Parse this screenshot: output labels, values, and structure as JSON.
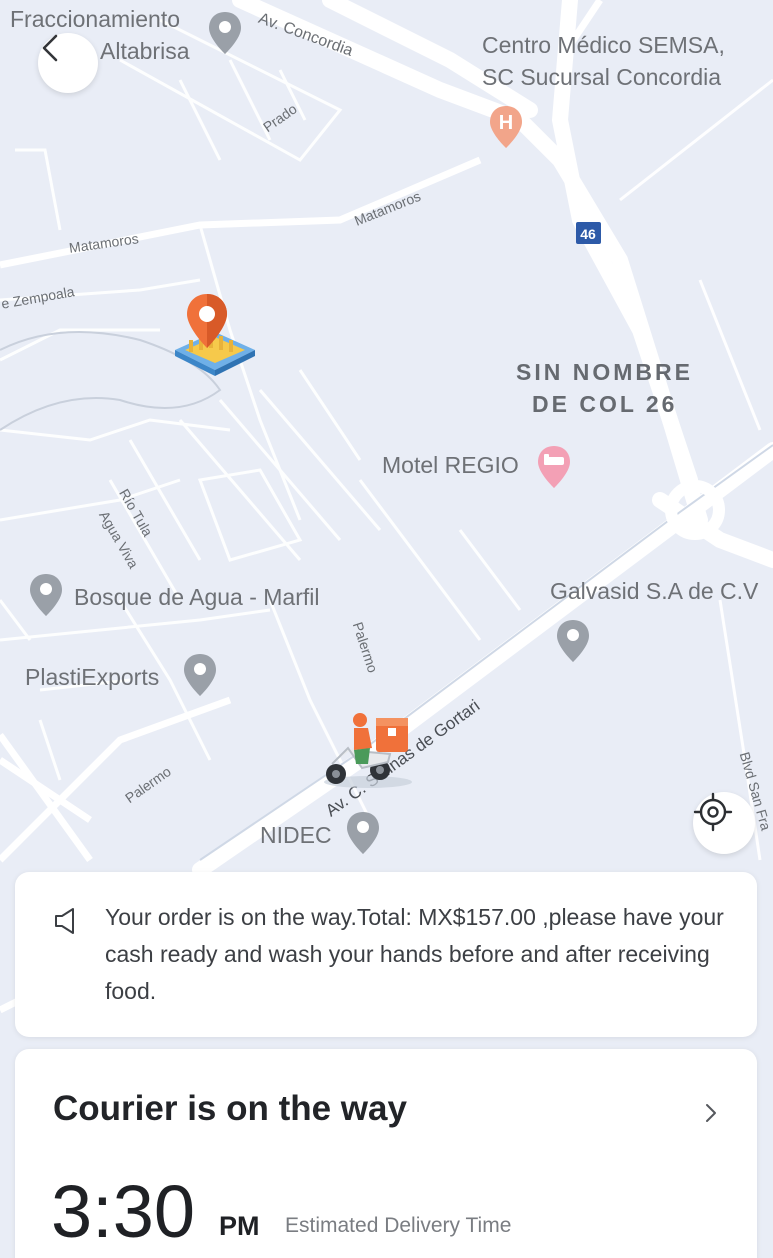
{
  "map": {
    "place_labels": {
      "fraccionamiento_l1": "Fraccionamiento",
      "fraccionamiento_l2": "Altabrisa",
      "centro_medico_l1": "Centro Médico SEMSA,",
      "centro_medico_l2": "SC Sucursal Concordia",
      "sin_nombre_l1": "SIN NOMBRE",
      "sin_nombre_l2": "DE COL 26",
      "motel": "Motel REGIO",
      "galvasid": "Galvasid S.A de C.V",
      "bosque": "Bosque de Agua - Marfil",
      "plasti": "PlastiExports",
      "nidec": "NIDEC"
    },
    "street_labels": {
      "concordia": "Av. Concordia",
      "prado": "Prado",
      "matamoros_a": "Matamoros",
      "matamoros_b": "Matamoros",
      "zempoala": "e Zempoala",
      "rio_tula": "Río Tula",
      "agua_viva": "Agua Viva",
      "palermo_a": "Palermo",
      "palermo_b": "Palermo",
      "salinas": "Av. C. Salinas de Gortari",
      "blvd": "Blvd San Fra"
    },
    "shield_46": "46",
    "hospital_letter": "H"
  },
  "notice": {
    "text": "Your order is on the way.Total: MX$157.00 ,please have your cash ready and wash your hands before and after receiving food."
  },
  "status": {
    "title": "Courier is on the way",
    "eta_time": "3:30",
    "eta_ampm": "PM",
    "eta_label": "Estimated Delivery Time"
  },
  "colors": {
    "map_bg": "#e9edf6",
    "road": "#ffffff",
    "accent_orange": "#f0713a",
    "hospital_pin": "#f2a58a",
    "motel_pin": "#f3a0b5",
    "poi_pin": "#9aa0a8"
  }
}
